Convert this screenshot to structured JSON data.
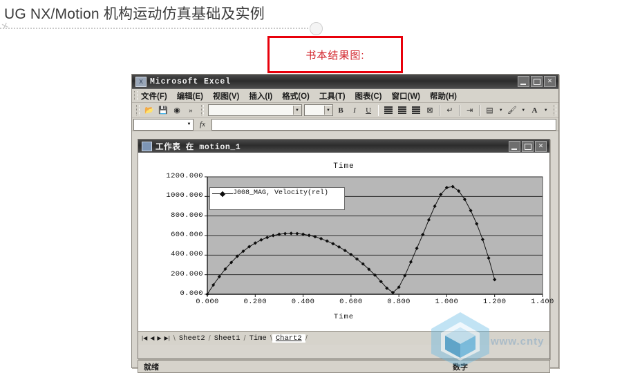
{
  "page": {
    "book_title": "UG NX/Motion 机构运动仿真基础及实例",
    "callout_text": "书本结果图:",
    "callout_border_color": "#e8000b",
    "callout_text_color": "#d2232a"
  },
  "excel": {
    "window_title": "Microsoft Excel",
    "app_icon": "excel-icon",
    "window_buttons": [
      {
        "name": "minimize",
        "glyph": "_"
      },
      {
        "name": "maximize",
        "glyph": "□"
      },
      {
        "name": "close",
        "glyph": "✕"
      }
    ],
    "menu": [
      {
        "label": "文件(F)"
      },
      {
        "label": "编辑(E)"
      },
      {
        "label": "视图(V)"
      },
      {
        "label": "插入(I)"
      },
      {
        "label": "格式(O)"
      },
      {
        "label": "工具(T)"
      },
      {
        "label": "图表(C)"
      },
      {
        "label": "窗口(W)"
      },
      {
        "label": "帮助(H)"
      }
    ],
    "toolbar": {
      "open_icon": "open-folder-icon",
      "save_icon": "save-disk-icon",
      "help_icon": "help-icon",
      "overflow_label": "»",
      "font_name_value": "",
      "font_size_value": "",
      "bold_label": "B",
      "italic_label": "I",
      "underline_label": "U",
      "align_left_icon": "align-left-icon",
      "align_center_icon": "align-center-icon",
      "align_right_icon": "align-right-icon",
      "merge_cells_icon": "merge-cells-icon",
      "wrap_icon": "wrap-text-icon",
      "indent_icon": "increase-indent-icon",
      "borders_icon": "borders-icon",
      "fill_color_icon": "fill-color-icon",
      "font_color_icon": "font-color-icon",
      "font_color_label": "A"
    },
    "formula_bar": {
      "name_box_value": "",
      "fx_label": "fx",
      "formula_value": ""
    },
    "sheet_window": {
      "title": "工作表 在 motion_1",
      "icon": "worksheet-icon",
      "window_buttons": [
        {
          "name": "minimize",
          "glyph": "_"
        },
        {
          "name": "maximize",
          "glyph": "□"
        },
        {
          "name": "close",
          "glyph": "✕"
        }
      ]
    },
    "sheet_tabs": {
      "nav": [
        "|◀",
        "◀",
        "▶",
        "▶|"
      ],
      "tabs": [
        {
          "label": "Sheet2",
          "active": false
        },
        {
          "label": "Sheet1",
          "active": false
        },
        {
          "label": "Time",
          "active": false
        },
        {
          "label": "Chart2",
          "active": true
        }
      ]
    },
    "status_bar": {
      "status": "就绪",
      "mode": "数字"
    }
  },
  "watermark": {
    "text": "www.cnty",
    "logo_icon": "cube-hexagon-logo",
    "color": "#6ec1e8"
  },
  "chart_data": {
    "type": "line",
    "title": "Time",
    "xlabel": "Time",
    "ylabel": "",
    "xlim": [
      0.0,
      1.4
    ],
    "ylim": [
      0.0,
      1200.0
    ],
    "xticks": [
      "0.000",
      "0.200",
      "0.400",
      "0.600",
      "0.800",
      "1.000",
      "1.200",
      "1.400"
    ],
    "xtick_values": [
      0.0,
      0.2,
      0.4,
      0.6,
      0.8,
      1.0,
      1.2,
      1.4
    ],
    "yticks": [
      "0.000",
      "200.000",
      "400.000",
      "600.000",
      "800.000",
      "1000.000",
      "1200.000"
    ],
    "ytick_values": [
      0,
      200,
      400,
      600,
      800,
      1000,
      1200
    ],
    "grid": "horizontal",
    "plot_bg": "#b7b7b7",
    "legend_position": "top-left",
    "legend": [
      "J008_MAG, Velocity(rel)"
    ],
    "marker": "diamond",
    "series": [
      {
        "name": "J008_MAG, Velocity(rel)",
        "x": [
          0.0,
          0.025,
          0.05,
          0.075,
          0.1,
          0.125,
          0.15,
          0.175,
          0.2,
          0.225,
          0.25,
          0.275,
          0.3,
          0.325,
          0.35,
          0.375,
          0.4,
          0.425,
          0.45,
          0.475,
          0.5,
          0.525,
          0.55,
          0.575,
          0.6,
          0.625,
          0.65,
          0.675,
          0.7,
          0.725,
          0.75,
          0.775,
          0.8,
          0.825,
          0.85,
          0.875,
          0.9,
          0.925,
          0.95,
          0.975,
          1.0,
          1.025,
          1.05,
          1.075,
          1.1,
          1.125,
          1.15,
          1.175,
          1.2
        ],
        "values": [
          0,
          95,
          180,
          258,
          325,
          388,
          440,
          486,
          523,
          556,
          580,
          600,
          613,
          620,
          622,
          620,
          613,
          602,
          588,
          568,
          544,
          516,
          484,
          447,
          406,
          360,
          310,
          255,
          196,
          130,
          62,
          18,
          72,
          190,
          330,
          470,
          610,
          760,
          900,
          1020,
          1090,
          1100,
          1055,
          970,
          855,
          720,
          560,
          370,
          150
        ]
      }
    ]
  }
}
